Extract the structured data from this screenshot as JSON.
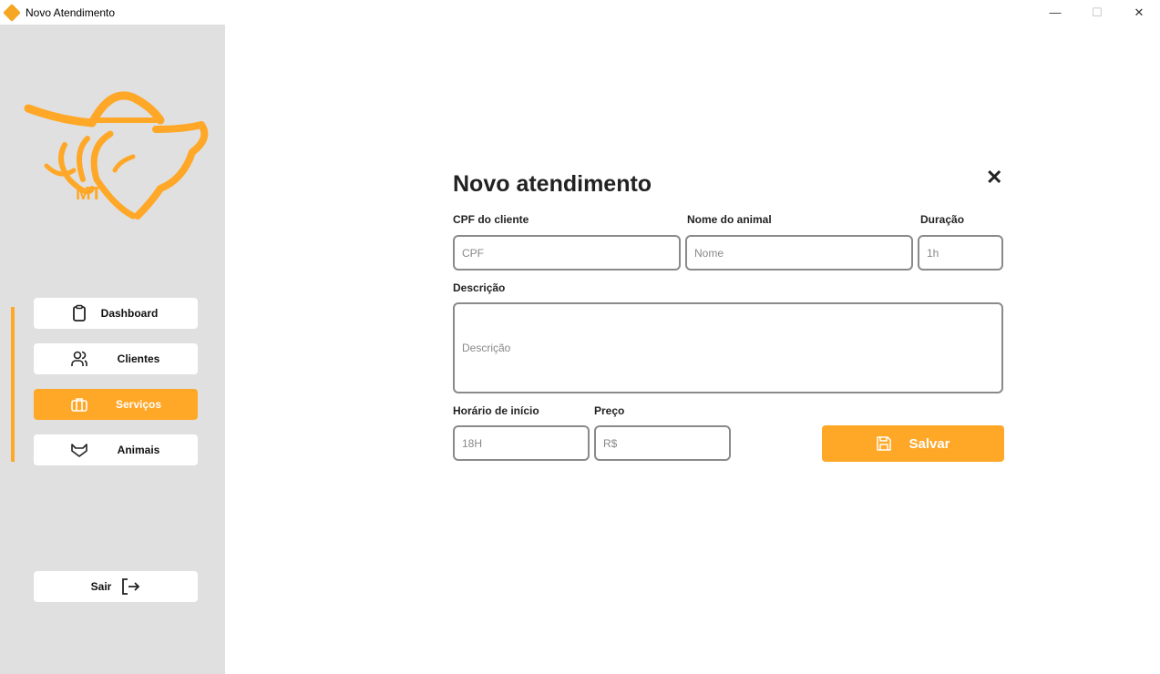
{
  "window": {
    "title": "Novo Atendimento",
    "minimize": "—",
    "maximize": "☐",
    "close": "✕"
  },
  "sidebar": {
    "logo_text": "MT",
    "items": [
      {
        "label": "Dashboard",
        "icon": "clipboard-icon"
      },
      {
        "label": "Clientes",
        "icon": "users-icon"
      },
      {
        "label": "Serviços",
        "icon": "briefcase-icon",
        "active": true
      },
      {
        "label": "Animais",
        "icon": "cat-icon"
      }
    ],
    "logout": "Sair"
  },
  "form": {
    "title": "Novo atendimento",
    "close": "✕",
    "cpf": {
      "label": "CPF do cliente",
      "placeholder": "CPF"
    },
    "animal": {
      "label": "Nome do animal",
      "placeholder": "Nome"
    },
    "duracao": {
      "label": "Duração",
      "placeholder": "1h"
    },
    "descricao": {
      "label": "Descrição",
      "placeholder": "Descrição"
    },
    "horario": {
      "label": "Horário de início",
      "placeholder": "18H"
    },
    "preco": {
      "label": "Preço",
      "placeholder": "R$"
    },
    "save": "Salvar"
  },
  "colors": {
    "accent": "#FFA726",
    "sidebar": "#E0E0E0"
  }
}
